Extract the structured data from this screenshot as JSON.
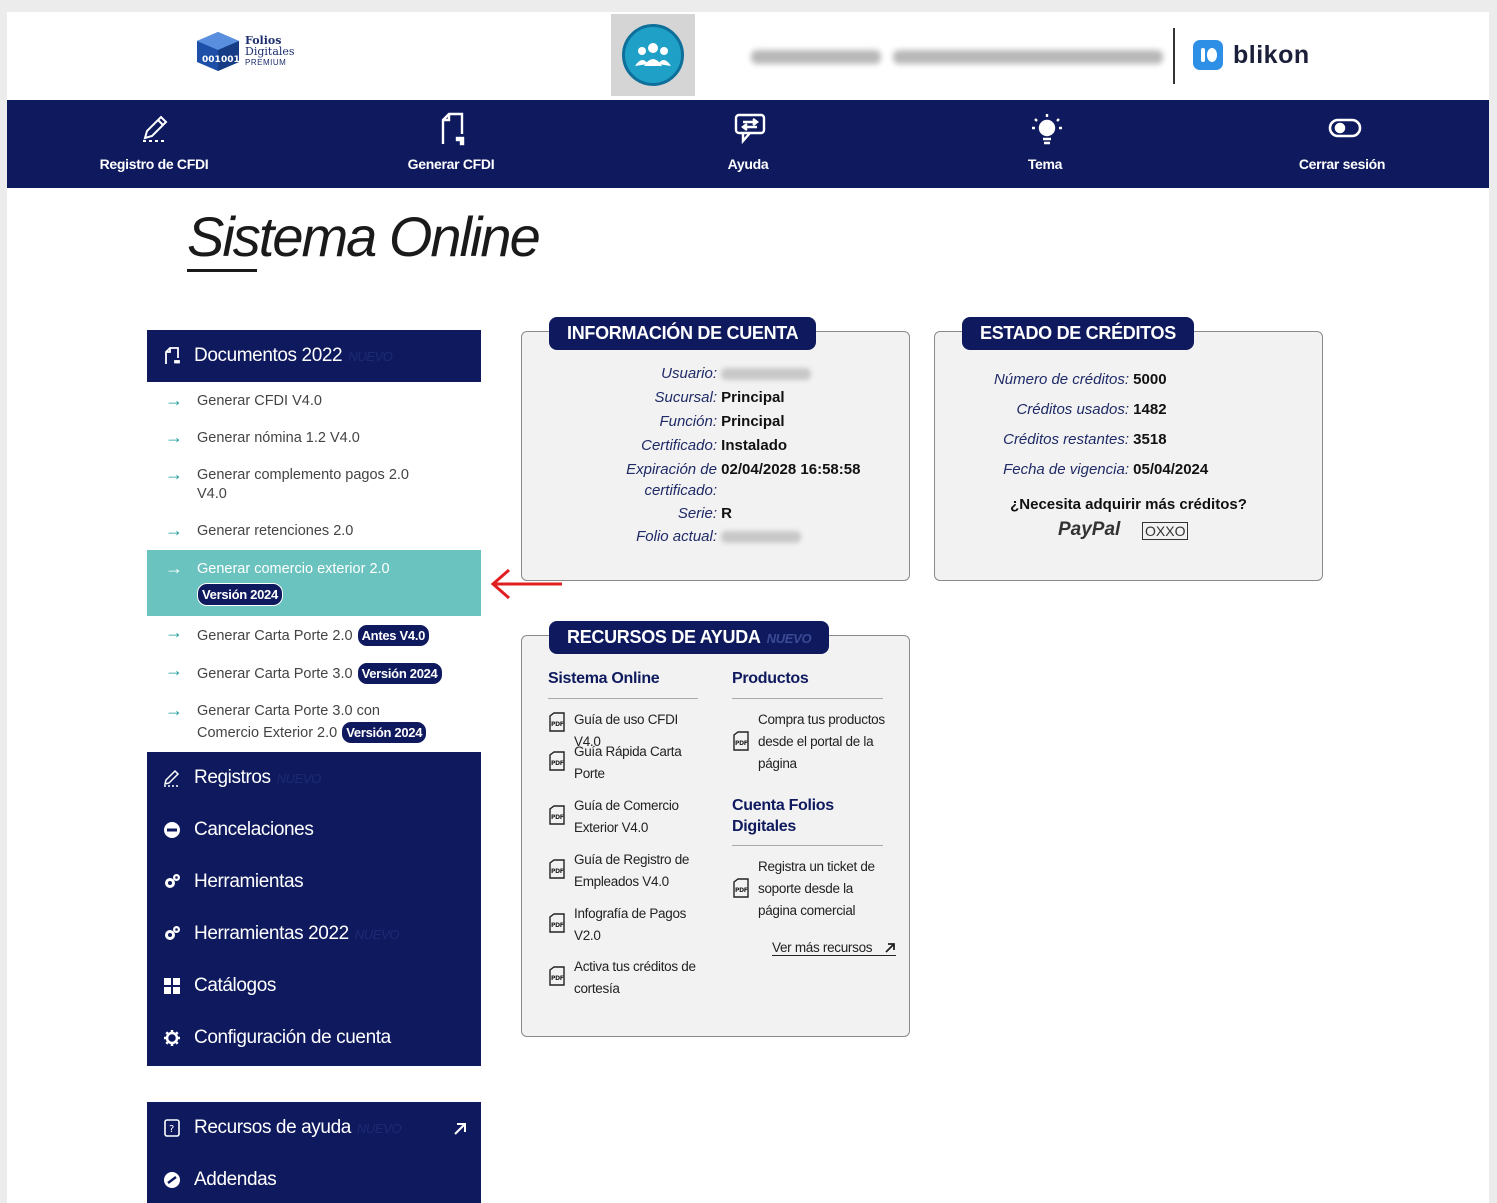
{
  "header": {
    "logo": {
      "line1": "Folios",
      "line2": "Digitales",
      "line3": "PREMIUM"
    },
    "partner": {
      "name": "blikon"
    }
  },
  "nav": [
    {
      "label": "Registro de CFDI",
      "icon": "pencil-icon"
    },
    {
      "label": "Generar CFDI",
      "icon": "document-icon"
    },
    {
      "label": "Ayuda",
      "icon": "chat-icon"
    },
    {
      "label": "Tema",
      "icon": "sun-icon"
    },
    {
      "label": "Cerrar sesión",
      "icon": "toggle-icon"
    }
  ],
  "page_title": "Sistema Online",
  "sidebar": {
    "documentos": {
      "label": "Documentos 2022",
      "tag": "NUEVO"
    },
    "sub_items": [
      {
        "label": "Generar CFDI V4.0"
      },
      {
        "label": "Generar nómina 1.2 V4.0"
      },
      {
        "label": "Generar complemento pagos 2.0 V4.0"
      },
      {
        "label": "Generar retenciones 2.0"
      },
      {
        "label": "Generar comercio exterior 2.0",
        "badge": "Versión 2024"
      },
      {
        "label": "Generar Carta Porte 2.0",
        "badge": "Antes V4.0"
      },
      {
        "label": "Generar Carta Porte 3.0",
        "badge": "Versión 2024"
      },
      {
        "label": "Generar Carta Porte 3.0 con Comercio Exterior 2.0",
        "badge": "Versión 2024"
      }
    ],
    "sections": [
      {
        "label": "Registros",
        "tag": "NUEVO",
        "icon": "pencil-icon"
      },
      {
        "label": "Cancelaciones",
        "icon": "minus-circle-icon"
      },
      {
        "label": "Herramientas",
        "icon": "gears-icon"
      },
      {
        "label": "Herramientas 2022",
        "tag": "NUEVO",
        "icon": "gears-icon"
      },
      {
        "label": "Catálogos",
        "icon": "grid-icon"
      },
      {
        "label": "Configuración de cuenta",
        "icon": "gear-icon"
      }
    ],
    "bottom": [
      {
        "label": "Recursos de ayuda",
        "tag": "NUEVO",
        "icon": "help-doc-icon"
      },
      {
        "label": "Addendas",
        "icon": "addenda-icon"
      }
    ]
  },
  "cuenta": {
    "title": "INFORMACIÓN DE CUENTA",
    "usuario_label": "Usuario:",
    "sucursal_label": "Sucursal:",
    "sucursal": "Principal",
    "funcion_label": "Función:",
    "funcion": "Principal",
    "certificado_label": "Certificado:",
    "certificado": "Instalado",
    "expiracion_label1": "Expiración de",
    "expiracion_label2": "certificado:",
    "expiracion": "02/04/2028 16:58:58",
    "serie_label": "Serie:",
    "serie": "R",
    "folio_label": "Folio actual:"
  },
  "creditos": {
    "title": "ESTADO DE CRÉDITOS",
    "numero_label": "Número de créditos:",
    "numero": "5000",
    "usados_label": "Créditos usados:",
    "usados": "1482",
    "restantes_label": "Créditos restantes:",
    "restantes": "3518",
    "vigencia_label": "Fecha de vigencia:",
    "vigencia": "05/04/2024",
    "question": "¿Necesita adquirir más créditos?",
    "paypal": "PayPal",
    "oxxo": "OXXO"
  },
  "recursos": {
    "title": "RECURSOS DE AYUDA",
    "tag": "NUEVO",
    "col1_title": "Sistema Online",
    "col1_items": [
      {
        "label": "Guía de uso CFDI V4.0"
      },
      {
        "label": "Guía Rápida Carta Porte"
      },
      {
        "label": "Guía de Comercio Exterior V4.0"
      },
      {
        "label": "Guía de Registro de Empleados V4.0"
      },
      {
        "label": "Infografía de Pagos V2.0"
      },
      {
        "label": "Activa tus créditos de cortesía"
      }
    ],
    "col2_title": "Productos",
    "col2_item": "Compra tus productos desde el portal de la página",
    "col3_title": "Cuenta Folios Digitales",
    "col3_item": "Registra un ticket de soporte desde la página comercial",
    "ver_mas": "Ver más recursos",
    "ver_mas_icon": "arrow-up-right-icon"
  },
  "colors": {
    "navy": "#0f1a5e",
    "teal": "#6bc3bf",
    "arrow_red": "#e02020"
  }
}
